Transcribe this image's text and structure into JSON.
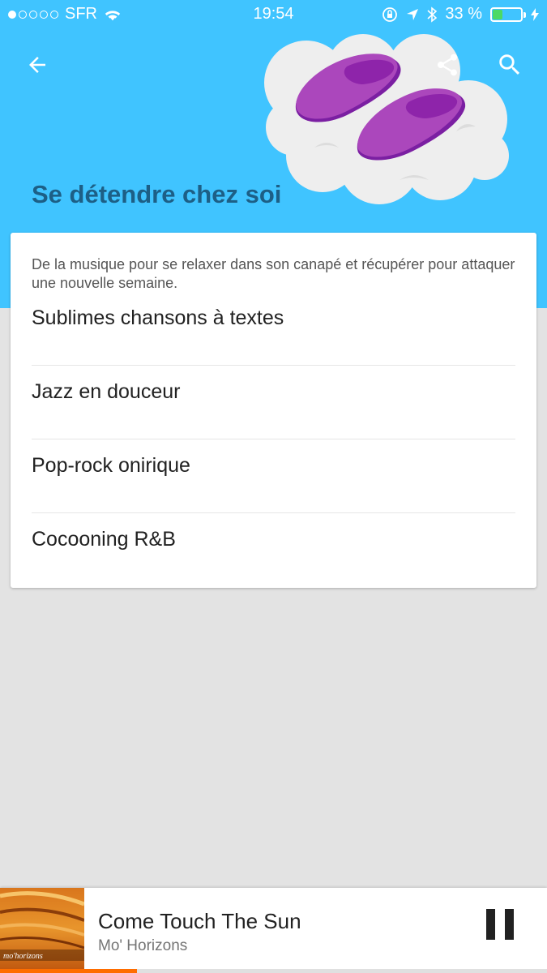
{
  "status_bar": {
    "carrier": "SFR",
    "time": "19:54",
    "battery_percent": "33 %",
    "battery_level": 0.33
  },
  "header": {
    "title": "Se détendre chez soi",
    "back_icon": "arrow-back-icon",
    "share_icon": "share-icon",
    "search_icon": "search-icon",
    "color": "#40c4ff",
    "title_color": "#1d5f86"
  },
  "card": {
    "description": "De la musique pour se relaxer dans son canapé et récupérer pour attaquer une nouvelle semaine.",
    "playlists": [
      {
        "label": "Sublimes chansons à textes"
      },
      {
        "label": "Jazz en douceur"
      },
      {
        "label": "Pop-rock onirique"
      },
      {
        "label": "Cocooning R&B"
      }
    ]
  },
  "player": {
    "title": "Come Touch The Sun",
    "artist": "Mo' Horizons",
    "album_text": "mo'horizons",
    "progress": 0.25,
    "accent": "#ff6d00"
  }
}
